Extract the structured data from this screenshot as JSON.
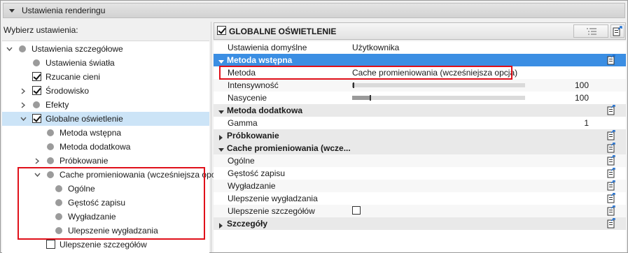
{
  "panel_title": "Ustawienia renderingu",
  "left": {
    "choose_label": "Wybierz ustawienia:",
    "tree": [
      {
        "label": "Ustawienia szczegółowe",
        "level": 0,
        "expander": "open",
        "mark": "dot"
      },
      {
        "label": "Ustawienia światła",
        "level": 1,
        "expander": "none",
        "mark": "dot"
      },
      {
        "label": "Rzucanie cieni",
        "level": 1,
        "expander": "none",
        "mark": "checked"
      },
      {
        "label": "Środowisko",
        "level": 1,
        "expander": "closed",
        "mark": "checked"
      },
      {
        "label": "Efekty",
        "level": 1,
        "expander": "closed",
        "mark": "dot"
      },
      {
        "label": "Globalne oświetlenie",
        "level": 1,
        "expander": "open",
        "mark": "checked",
        "selected": true
      },
      {
        "label": "Metoda wstępna",
        "level": 2,
        "expander": "none",
        "mark": "dot"
      },
      {
        "label": "Metoda dodatkowa",
        "level": 2,
        "expander": "none",
        "mark": "dot"
      },
      {
        "label": "Próbkowanie",
        "level": 2,
        "expander": "closed",
        "mark": "dot"
      },
      {
        "label": "Cache promieniowania (wcześniejsza opcja)",
        "level": 2,
        "expander": "open",
        "mark": "dot"
      },
      {
        "label": "Ogólne",
        "level": 3,
        "expander": "none",
        "mark": "dot"
      },
      {
        "label": "Gęstość zapisu",
        "level": 3,
        "expander": "none",
        "mark": "dot"
      },
      {
        "label": "Wygładzanie",
        "level": 3,
        "expander": "none",
        "mark": "dot"
      },
      {
        "label": "Ulepszenie wygładzania",
        "level": 3,
        "expander": "none",
        "mark": "dot"
      },
      {
        "label": "Ulepszenie szczegółów",
        "level": 2,
        "expander": "none",
        "mark": "unchecked"
      }
    ]
  },
  "right": {
    "header_title": "GLOBALNE OŚWIETLENIE",
    "header_checked": true,
    "rows": [
      {
        "type": "prop",
        "key": "Ustawienia domyślne",
        "value": "Użytkownika"
      },
      {
        "type": "group",
        "key": "Metoda wstępna",
        "selected": true,
        "icon": true
      },
      {
        "type": "prop",
        "key": "Metoda",
        "value": "Cache promieniowania (wcześniejsza opcja)"
      },
      {
        "type": "slider",
        "key": "Intensywność",
        "value": "100",
        "level": 0.005
      },
      {
        "type": "slider",
        "key": "Nasycenie",
        "value": "100",
        "level": 0.1
      },
      {
        "type": "group",
        "key": "Metoda dodatkowa",
        "icon": true
      },
      {
        "type": "prop",
        "key": "Gamma",
        "value": "",
        "number": "1"
      },
      {
        "type": "group",
        "key": "Próbkowanie",
        "collapsed": true,
        "icon": true
      },
      {
        "type": "group",
        "key": "Cache promieniowania (wcze...",
        "icon": true
      },
      {
        "type": "prop",
        "key": "Ogólne",
        "icon": true
      },
      {
        "type": "prop",
        "key": "Gęstość zapisu",
        "icon": true
      },
      {
        "type": "prop",
        "key": "Wygładzanie",
        "icon": true
      },
      {
        "type": "prop",
        "key": "Ulepszenie wygładzania",
        "icon": true
      },
      {
        "type": "check",
        "key": "Ulepszenie szczegółów",
        "checked": false,
        "icon": true
      },
      {
        "type": "group",
        "key": "Szczegóły",
        "collapsed": true,
        "icon": true
      }
    ]
  },
  "colors": {
    "highlight": "#e0101a",
    "selection_blue": "#3b8ee3",
    "tree_selection": "#cce4f7"
  }
}
